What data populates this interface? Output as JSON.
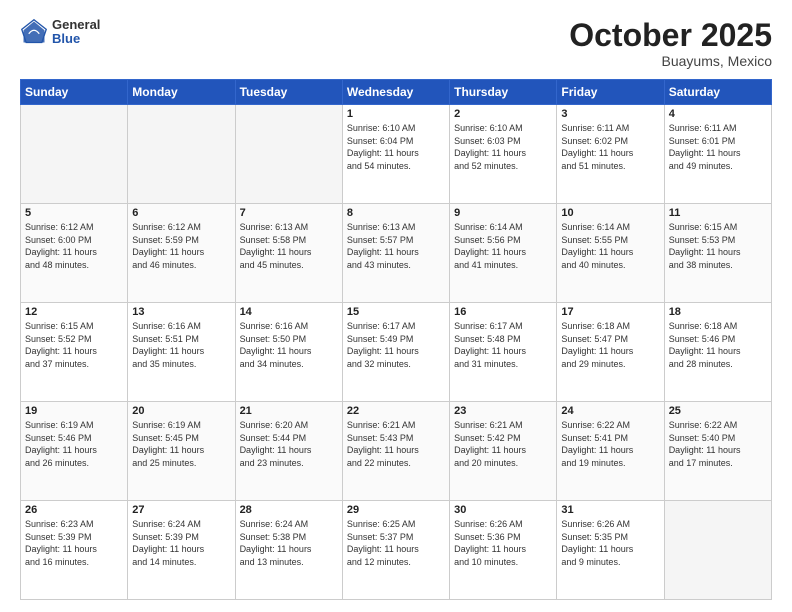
{
  "header": {
    "logo_general": "General",
    "logo_blue": "Blue",
    "month": "October 2025",
    "location": "Buayums, Mexico"
  },
  "weekdays": [
    "Sunday",
    "Monday",
    "Tuesday",
    "Wednesday",
    "Thursday",
    "Friday",
    "Saturday"
  ],
  "weeks": [
    [
      {
        "day": "",
        "info": ""
      },
      {
        "day": "",
        "info": ""
      },
      {
        "day": "",
        "info": ""
      },
      {
        "day": "1",
        "info": "Sunrise: 6:10 AM\nSunset: 6:04 PM\nDaylight: 11 hours\nand 54 minutes."
      },
      {
        "day": "2",
        "info": "Sunrise: 6:10 AM\nSunset: 6:03 PM\nDaylight: 11 hours\nand 52 minutes."
      },
      {
        "day": "3",
        "info": "Sunrise: 6:11 AM\nSunset: 6:02 PM\nDaylight: 11 hours\nand 51 minutes."
      },
      {
        "day": "4",
        "info": "Sunrise: 6:11 AM\nSunset: 6:01 PM\nDaylight: 11 hours\nand 49 minutes."
      }
    ],
    [
      {
        "day": "5",
        "info": "Sunrise: 6:12 AM\nSunset: 6:00 PM\nDaylight: 11 hours\nand 48 minutes."
      },
      {
        "day": "6",
        "info": "Sunrise: 6:12 AM\nSunset: 5:59 PM\nDaylight: 11 hours\nand 46 minutes."
      },
      {
        "day": "7",
        "info": "Sunrise: 6:13 AM\nSunset: 5:58 PM\nDaylight: 11 hours\nand 45 minutes."
      },
      {
        "day": "8",
        "info": "Sunrise: 6:13 AM\nSunset: 5:57 PM\nDaylight: 11 hours\nand 43 minutes."
      },
      {
        "day": "9",
        "info": "Sunrise: 6:14 AM\nSunset: 5:56 PM\nDaylight: 11 hours\nand 41 minutes."
      },
      {
        "day": "10",
        "info": "Sunrise: 6:14 AM\nSunset: 5:55 PM\nDaylight: 11 hours\nand 40 minutes."
      },
      {
        "day": "11",
        "info": "Sunrise: 6:15 AM\nSunset: 5:53 PM\nDaylight: 11 hours\nand 38 minutes."
      }
    ],
    [
      {
        "day": "12",
        "info": "Sunrise: 6:15 AM\nSunset: 5:52 PM\nDaylight: 11 hours\nand 37 minutes."
      },
      {
        "day": "13",
        "info": "Sunrise: 6:16 AM\nSunset: 5:51 PM\nDaylight: 11 hours\nand 35 minutes."
      },
      {
        "day": "14",
        "info": "Sunrise: 6:16 AM\nSunset: 5:50 PM\nDaylight: 11 hours\nand 34 minutes."
      },
      {
        "day": "15",
        "info": "Sunrise: 6:17 AM\nSunset: 5:49 PM\nDaylight: 11 hours\nand 32 minutes."
      },
      {
        "day": "16",
        "info": "Sunrise: 6:17 AM\nSunset: 5:48 PM\nDaylight: 11 hours\nand 31 minutes."
      },
      {
        "day": "17",
        "info": "Sunrise: 6:18 AM\nSunset: 5:47 PM\nDaylight: 11 hours\nand 29 minutes."
      },
      {
        "day": "18",
        "info": "Sunrise: 6:18 AM\nSunset: 5:46 PM\nDaylight: 11 hours\nand 28 minutes."
      }
    ],
    [
      {
        "day": "19",
        "info": "Sunrise: 6:19 AM\nSunset: 5:46 PM\nDaylight: 11 hours\nand 26 minutes."
      },
      {
        "day": "20",
        "info": "Sunrise: 6:19 AM\nSunset: 5:45 PM\nDaylight: 11 hours\nand 25 minutes."
      },
      {
        "day": "21",
        "info": "Sunrise: 6:20 AM\nSunset: 5:44 PM\nDaylight: 11 hours\nand 23 minutes."
      },
      {
        "day": "22",
        "info": "Sunrise: 6:21 AM\nSunset: 5:43 PM\nDaylight: 11 hours\nand 22 minutes."
      },
      {
        "day": "23",
        "info": "Sunrise: 6:21 AM\nSunset: 5:42 PM\nDaylight: 11 hours\nand 20 minutes."
      },
      {
        "day": "24",
        "info": "Sunrise: 6:22 AM\nSunset: 5:41 PM\nDaylight: 11 hours\nand 19 minutes."
      },
      {
        "day": "25",
        "info": "Sunrise: 6:22 AM\nSunset: 5:40 PM\nDaylight: 11 hours\nand 17 minutes."
      }
    ],
    [
      {
        "day": "26",
        "info": "Sunrise: 6:23 AM\nSunset: 5:39 PM\nDaylight: 11 hours\nand 16 minutes."
      },
      {
        "day": "27",
        "info": "Sunrise: 6:24 AM\nSunset: 5:39 PM\nDaylight: 11 hours\nand 14 minutes."
      },
      {
        "day": "28",
        "info": "Sunrise: 6:24 AM\nSunset: 5:38 PM\nDaylight: 11 hours\nand 13 minutes."
      },
      {
        "day": "29",
        "info": "Sunrise: 6:25 AM\nSunset: 5:37 PM\nDaylight: 11 hours\nand 12 minutes."
      },
      {
        "day": "30",
        "info": "Sunrise: 6:26 AM\nSunset: 5:36 PM\nDaylight: 11 hours\nand 10 minutes."
      },
      {
        "day": "31",
        "info": "Sunrise: 6:26 AM\nSunset: 5:35 PM\nDaylight: 11 hours\nand 9 minutes."
      },
      {
        "day": "",
        "info": ""
      }
    ]
  ]
}
